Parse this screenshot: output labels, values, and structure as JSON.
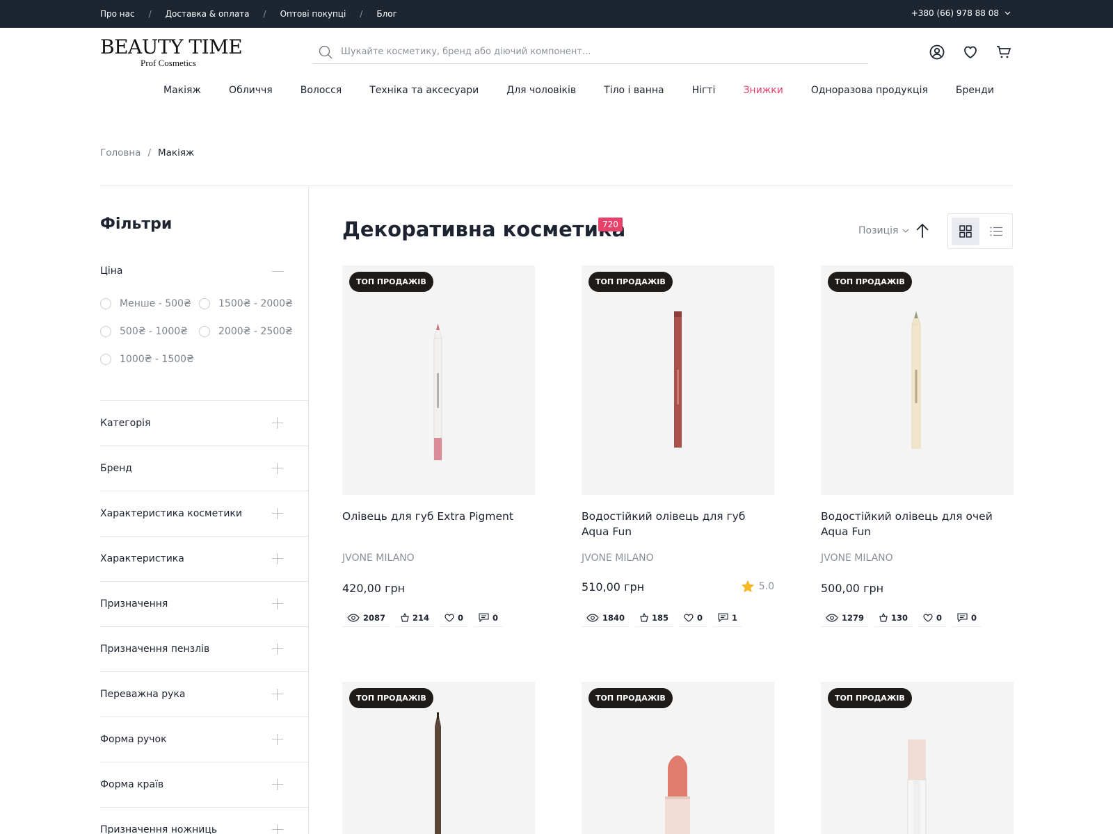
{
  "topbar": {
    "links": [
      "Про нас",
      "Доставка & оплата",
      "Оптові покупці",
      "Блог"
    ],
    "phone": "+380 (66) 978 88 08"
  },
  "header": {
    "logo_main": "BEAUTY TIME",
    "logo_sub": "Prof Cosmetics",
    "search_placeholder": "Шукайте косметику, бренд або діючий компонент..."
  },
  "nav": [
    "Макіяж",
    "Обличчя",
    "Волосся",
    "Техніка та аксесуари",
    "Для чоловіків",
    "Тіло і ванна",
    "Нігті",
    "Знижки",
    "Одноразова продукція",
    "Бренди"
  ],
  "breadcrumb": {
    "home": "Головна",
    "sep": "/",
    "current": "Макіяж"
  },
  "filters": {
    "title": "Фільтри",
    "price_title": "Ціна",
    "price_options": [
      "Менше - 500₴",
      "500₴ - 1000₴",
      "1000₴ - 1500₴",
      "1500₴ - 2000₴",
      "2000₴ - 2500₴"
    ],
    "facets": [
      "Категорія",
      "Бренд",
      "Характеристика косметики",
      "Характеристика",
      "Призначення",
      "Призначення пензлів",
      "Переважна рука",
      "Форма ручок",
      "Форма країв",
      "Призначення ножниць"
    ]
  },
  "catalog": {
    "title": "Декоративна косметика",
    "count": "720",
    "sort_label": "Позиція"
  },
  "colors": {
    "accent": "#e8416a",
    "topbar": "#1d2531",
    "badge": "#1e1b18",
    "star": "#f5b826"
  },
  "products": [
    {
      "badge": "ТОП ПРОДАЖІВ",
      "name": "Олівець для губ Extra Pigment",
      "brand": "JVONE MILANO",
      "price": "420,00 грн",
      "rating": "",
      "views": "2087",
      "orders": "214",
      "likes": "0",
      "comments": "0",
      "image": "pink-lip-pencil"
    },
    {
      "badge": "ТОП ПРОДАЖІВ",
      "name": "Водостійкий олівець для губ Aqua Fun",
      "brand": "JVONE MILANO",
      "price": "510,00 грн",
      "rating": "5.0",
      "views": "1840",
      "orders": "185",
      "likes": "0",
      "comments": "1",
      "image": "red-lip-pencil"
    },
    {
      "badge": "ТОП ПРОДАЖІВ",
      "name": "Водостійкий олівець для очей Aqua Fun",
      "brand": "JVONE MILANO",
      "price": "500,00 грн",
      "rating": "",
      "views": "1279",
      "orders": "130",
      "likes": "0",
      "comments": "0",
      "image": "beige-eye-pencil"
    },
    {
      "badge": "ТОП ПРОДАЖІВ",
      "image": "brown-eye-pencil"
    },
    {
      "badge": "ТОП ПРОДАЖІВ",
      "image": "coral-lipstick"
    },
    {
      "badge": "ТОП ПРОДАЖІВ",
      "image": "lip-gloss"
    }
  ]
}
